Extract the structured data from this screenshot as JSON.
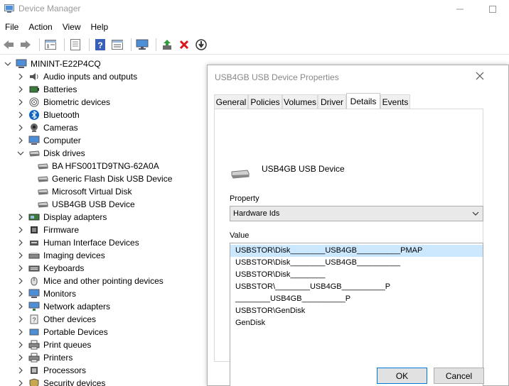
{
  "window": {
    "title": "Device Manager"
  },
  "menu": [
    "File",
    "Action",
    "View",
    "Help"
  ],
  "toolbar": {
    "icons": [
      "back-arrow-icon",
      "forward-arrow-icon",
      "show-hide-tree-icon",
      "properties-icon",
      "help-icon",
      "view-icon",
      "monitor-icon",
      "update-driver-icon",
      "uninstall-icon",
      "scan-download-icon"
    ]
  },
  "tree": {
    "root": "MININT-E22P4CQ",
    "items": [
      {
        "label": "Audio inputs and outputs",
        "icon": "speaker-icon",
        "expanded": false
      },
      {
        "label": "Batteries",
        "icon": "battery-icon",
        "expanded": false
      },
      {
        "label": "Biometric devices",
        "icon": "fingerprint-icon",
        "expanded": false
      },
      {
        "label": "Bluetooth",
        "icon": "bluetooth-icon",
        "expanded": false
      },
      {
        "label": "Cameras",
        "icon": "camera-icon",
        "expanded": false
      },
      {
        "label": "Computer",
        "icon": "computer-icon",
        "expanded": false
      },
      {
        "label": "Disk drives",
        "icon": "disk-drive-icon",
        "expanded": true
      },
      {
        "label": "BA HFS001TD9TNG-62A0A",
        "icon": "disk-drive-icon",
        "child": true
      },
      {
        "label": "Generic Flash Disk USB Device",
        "icon": "disk-drive-icon",
        "child": true
      },
      {
        "label": "Microsoft Virtual Disk",
        "icon": "disk-drive-icon",
        "child": true
      },
      {
        "label": "USB4GB USB Device",
        "icon": "disk-drive-icon",
        "child": true
      },
      {
        "label": "Display adapters",
        "icon": "display-adapter-icon",
        "expanded": false
      },
      {
        "label": "Firmware",
        "icon": "chip-icon",
        "expanded": false
      },
      {
        "label": "Human Interface Devices",
        "icon": "hid-icon",
        "expanded": false
      },
      {
        "label": "Imaging devices",
        "icon": "scanner-icon",
        "expanded": false
      },
      {
        "label": "Keyboards",
        "icon": "keyboard-icon",
        "expanded": false
      },
      {
        "label": "Mice and other pointing devices",
        "icon": "mouse-icon",
        "expanded": false
      },
      {
        "label": "Monitors",
        "icon": "monitor-icon",
        "expanded": false
      },
      {
        "label": "Network adapters",
        "icon": "network-icon",
        "expanded": false
      },
      {
        "label": "Other devices",
        "icon": "unknown-device-icon",
        "expanded": false
      },
      {
        "label": "Portable Devices",
        "icon": "portable-device-icon",
        "expanded": false
      },
      {
        "label": "Print queues",
        "icon": "printer-icon",
        "expanded": false
      },
      {
        "label": "Printers",
        "icon": "printer-icon",
        "expanded": false
      },
      {
        "label": "Processors",
        "icon": "processor-icon",
        "expanded": false
      },
      {
        "label": "Security devices",
        "icon": "security-icon",
        "expanded": false
      }
    ]
  },
  "dialog": {
    "title": "USB4GB USB Device Properties",
    "tabs": [
      "General",
      "Policies",
      "Volumes",
      "Driver",
      "Details",
      "Events"
    ],
    "active_tab": "Details",
    "device_name": "USB4GB USB Device",
    "property_label": "Property",
    "property_value": "Hardware Ids",
    "value_label": "Value",
    "values": [
      "USBSTOR\\Disk________USB4GB__________PMAP",
      "USBSTOR\\Disk________USB4GB__________",
      "USBSTOR\\Disk________",
      "USBSTOR\\________USB4GB__________P",
      "________USB4GB__________P",
      "USBSTOR\\GenDisk",
      "GenDisk"
    ],
    "ok_label": "OK",
    "cancel_label": "Cancel"
  },
  "colors": {
    "selection": "#cce8ff",
    "accent": "#0078d7"
  }
}
